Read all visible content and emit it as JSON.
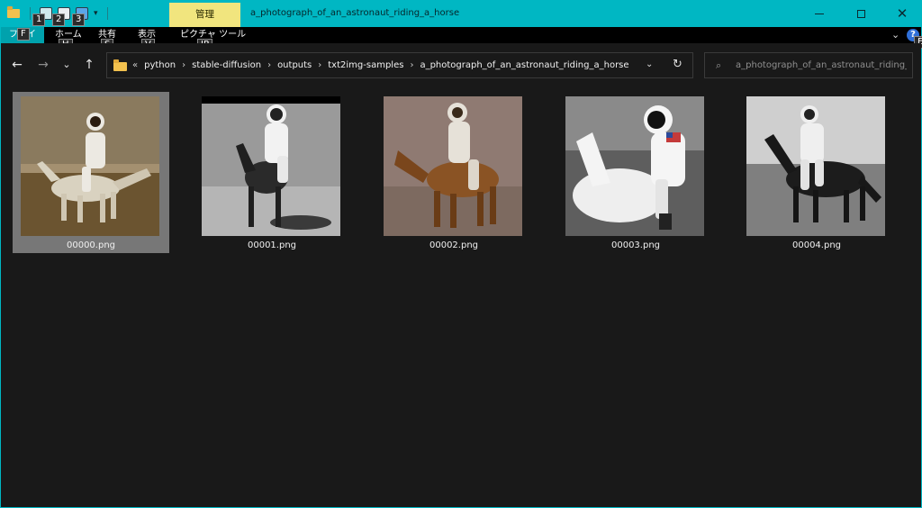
{
  "window": {
    "title": "a_photograph_of_an_astronaut_riding_a_horse",
    "manage_tab": "管理",
    "qat_badges": [
      "1",
      "2",
      "3"
    ]
  },
  "ribbon": {
    "tabs": [
      {
        "label": "ファイル",
        "key": "F"
      },
      {
        "label": "ホーム",
        "key": "H"
      },
      {
        "label": "共有",
        "key": "S"
      },
      {
        "label": "表示",
        "key": "V"
      },
      {
        "label": "ピクチャ ツール",
        "key": "JP"
      }
    ],
    "help_key": "E"
  },
  "addressbar": {
    "overflow": "«",
    "crumbs": [
      "python",
      "stable-diffusion",
      "outputs",
      "txt2img-samples",
      "a_photograph_of_an_astronaut_riding_a_horse"
    ]
  },
  "search": {
    "placeholder": "a_photograph_of_an_astronaut_riding_a_h..."
  },
  "files": [
    {
      "name": "00000.png",
      "selected": true
    },
    {
      "name": "00001.png",
      "selected": false
    },
    {
      "name": "00002.png",
      "selected": false
    },
    {
      "name": "00003.png",
      "selected": false
    },
    {
      "name": "00004.png",
      "selected": false
    }
  ],
  "icons": {
    "back": "arrow-left-icon",
    "forward": "arrow-right-icon",
    "recent": "chevron-down-icon",
    "up": "arrow-up-icon",
    "refresh": "refresh-icon",
    "search": "search-icon"
  },
  "colors": {
    "titlebar": "#00b7c3",
    "manage_tab": "#f1e57e",
    "background": "#191919",
    "selection": "#777777"
  }
}
